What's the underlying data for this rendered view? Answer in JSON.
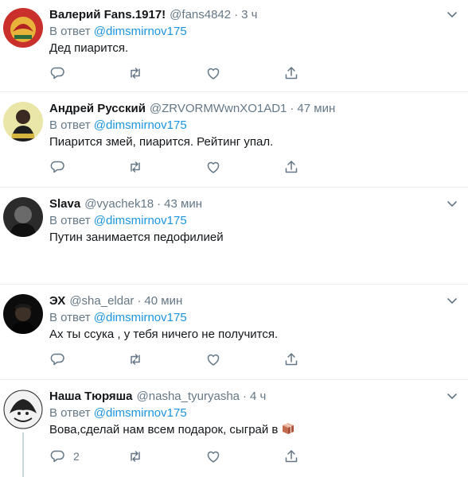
{
  "reply_prefix": "В ответ",
  "tweets": [
    {
      "name": "Валерий Fans.1917!",
      "handle": "@fans4842",
      "time": "3 ч",
      "mention": "@dimsmirnov175",
      "text": "Дед пиарится.",
      "reply_count": ""
    },
    {
      "name": "Андрей Русский",
      "handle": "@ZRVORMWwnXO1AD1",
      "time": "47 мин",
      "mention": "@dimsmirnov175",
      "text": "Пиарится змей, пиарится. Рейтинг упал.",
      "reply_count": ""
    },
    {
      "name": "Slava",
      "handle": "@vyachek18",
      "time": "43 мин",
      "mention": "",
      "text": "Путин занимается педофилией",
      "reply_count": ""
    },
    {
      "name": "ЭХ",
      "handle": "@sha_eldar",
      "time": "40 мин",
      "mention": "@dimsmirnov175",
      "text": "Ах ты ссука , у тебя ничего не получится.",
      "reply_count": ""
    },
    {
      "name": "Наша Тюряша",
      "handle": "@nasha_tyuryasha",
      "time": "4 ч",
      "mention": "@dimsmirnov175",
      "text": "Вова,сделай нам всем подарок, сыграй в",
      "reply_count": "2"
    }
  ],
  "icons": {
    "reply": "reply-icon",
    "retweet": "retweet-icon",
    "like": "heart-icon",
    "share": "share-icon",
    "more": "chevron-down-icon"
  },
  "colors": {
    "accent": "#1b95e0",
    "muted": "#657786",
    "divider": "#e6ecf0"
  }
}
